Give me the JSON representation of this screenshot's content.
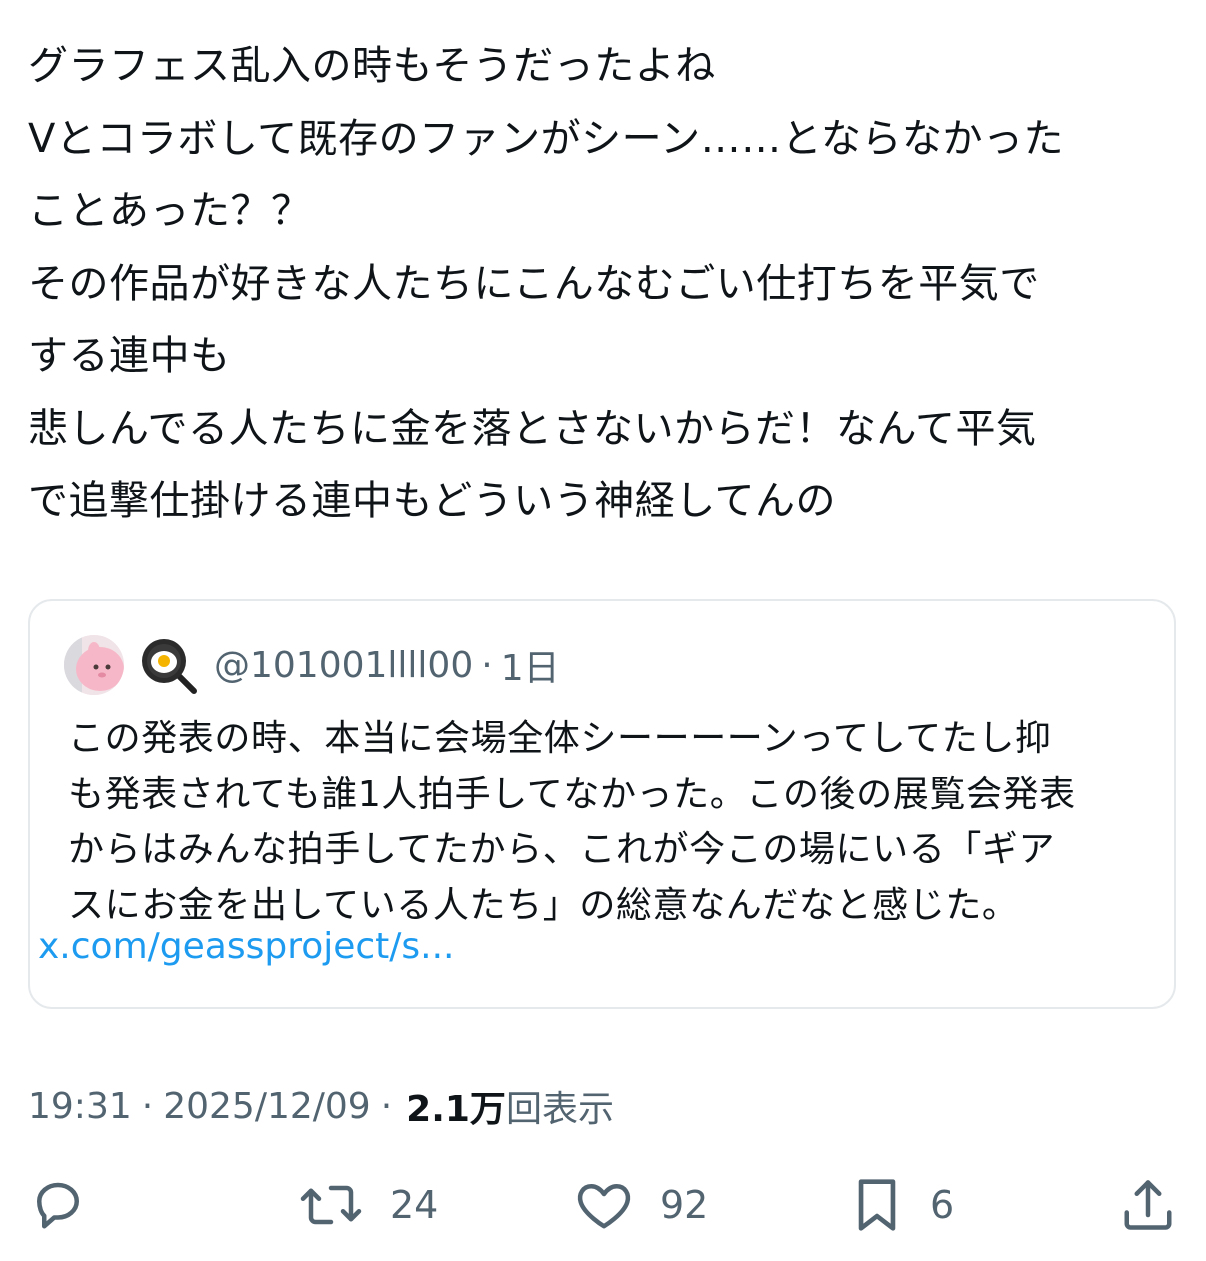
{
  "tweet": {
    "lines": [
      "グラフェス乱入の時もそうだったよね",
      "Vとコラボして既存のファンがシーン……とならなかった",
      "ことあった？？",
      "その作品が好きな人たちにこんなむごい仕打ちを平気で",
      "する連中も",
      "悲しんでる人たちに金を落とさないからだ！なんて平気",
      "で追撃仕掛ける連中もどういう神経してんの"
    ]
  },
  "quote": {
    "avatar_icon": "character-avatar",
    "emoji_icon": "frying-pan-egg-icon",
    "handle": "@101001llll00",
    "separator": "·",
    "time": "1日",
    "lines": [
      "この発表の時、本当に会場全体シーーーーンってしてたし抑",
      "も発表されても誰1人拍手してなかった。この後の展覧会発表",
      "からはみんな拍手してたから、これが今この場にいる「ギア",
      "スにお金を出している人たち」の総意なんだなと感じた。"
    ],
    "link": "x.com/geassproject/s..."
  },
  "meta": {
    "time": "19:31",
    "sep1": "·",
    "date": "2025/12/09",
    "sep2": "·",
    "views_count": "2.1万",
    "views_label": "回表示"
  },
  "actions": {
    "reply_icon": "reply-icon",
    "retweet_icon": "retweet-icon",
    "retweet_count": "24",
    "like_icon": "heart-icon",
    "like_count": "92",
    "bookmark_icon": "bookmark-icon",
    "bookmark_count": "6",
    "share_icon": "share-icon"
  },
  "colors": {
    "text": "#0f1419",
    "secondary": "#536471",
    "link": "#1d9bf0",
    "border": "#e6e9ec"
  }
}
